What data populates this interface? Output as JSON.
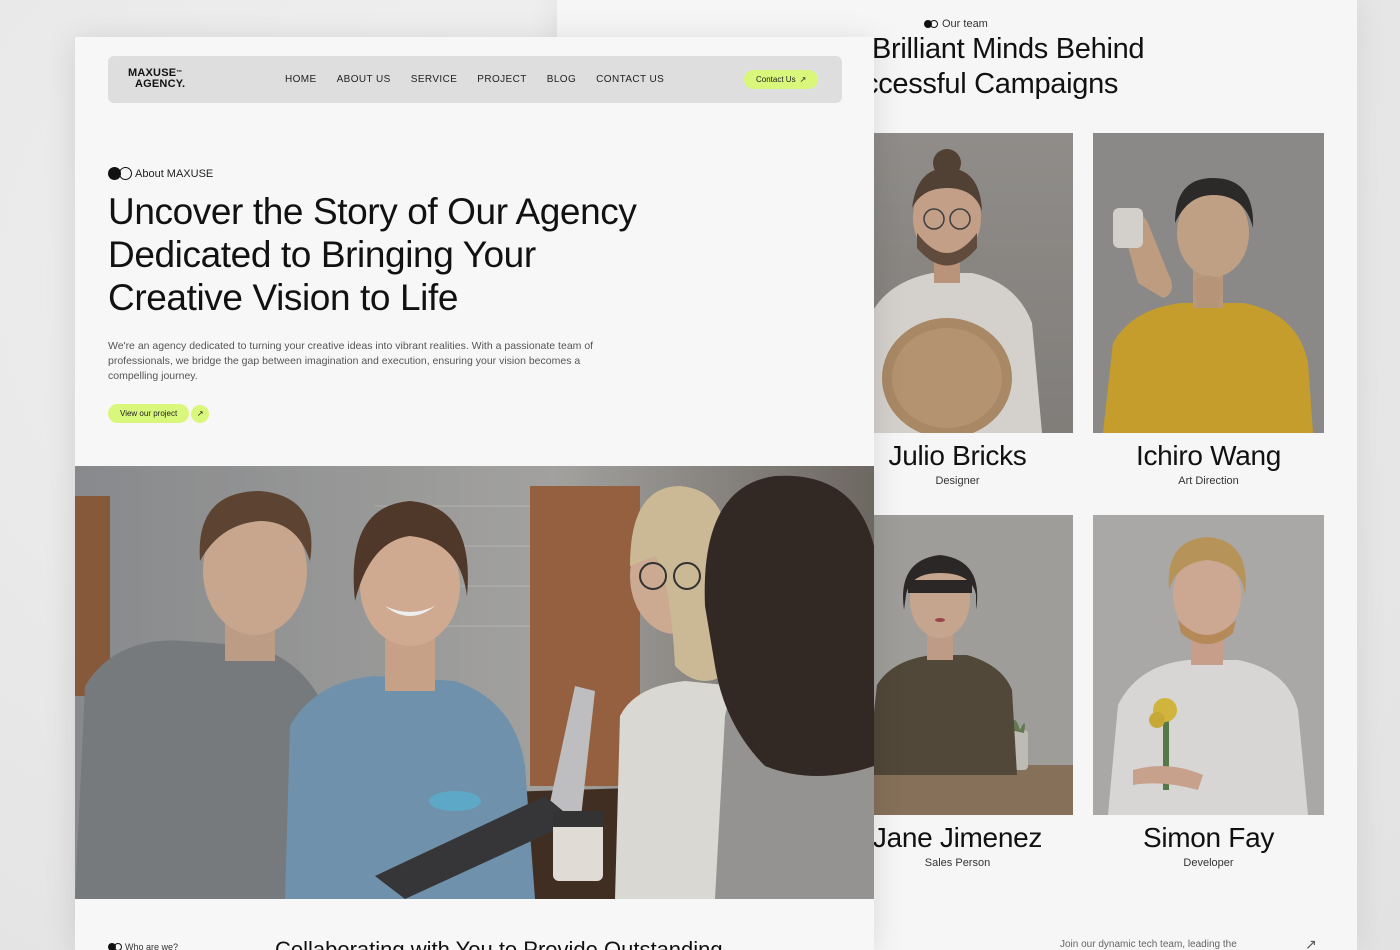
{
  "team_page": {
    "eyebrow": "Our team",
    "title_line1": "Brilliant Minds Behind",
    "title_line2": "ccessful Campaigns",
    "members": [
      {
        "name": "Julio Bricks",
        "role": "Designer"
      },
      {
        "name": "Ichiro Wang",
        "role": "Art Direction"
      },
      {
        "name": "Jane Jimenez",
        "role": "Sales Person"
      },
      {
        "name": "Simon Fay",
        "role": "Developer"
      }
    ],
    "join_text": "Join our dynamic tech team, leading the",
    "join_arrow": "↗"
  },
  "about_page": {
    "logo_line1": "MAXUSE",
    "logo_tm": "™",
    "logo_line2": "AGENCY.",
    "nav": [
      "HOME",
      "ABOUT US",
      "SERVICE",
      "PROJECT",
      "BLOG",
      "CONTACT US"
    ],
    "contact_label": "Contact Us",
    "arrow": "↗",
    "eyebrow": "About MAXUSE",
    "hero_title": "Uncover the Story of Our Agency Dedicated to Bringing Your Creative Vision to Life",
    "hero_desc": "We're an agency dedicated to turning your creative ideas into vibrant realities. With a passionate team of professionals, we bridge the gap between imagination and execution, ensuring your vision becomes a compelling journey.",
    "cta_label": "View our project",
    "who_eyebrow": "Who are we?",
    "collab_text": "Collaborating with You to Provide Outstanding"
  },
  "colors": {
    "accent": "#d9f77a",
    "navbar_bg": "#dedede",
    "page_bg": "#f7f7f7",
    "text": "#111111"
  }
}
